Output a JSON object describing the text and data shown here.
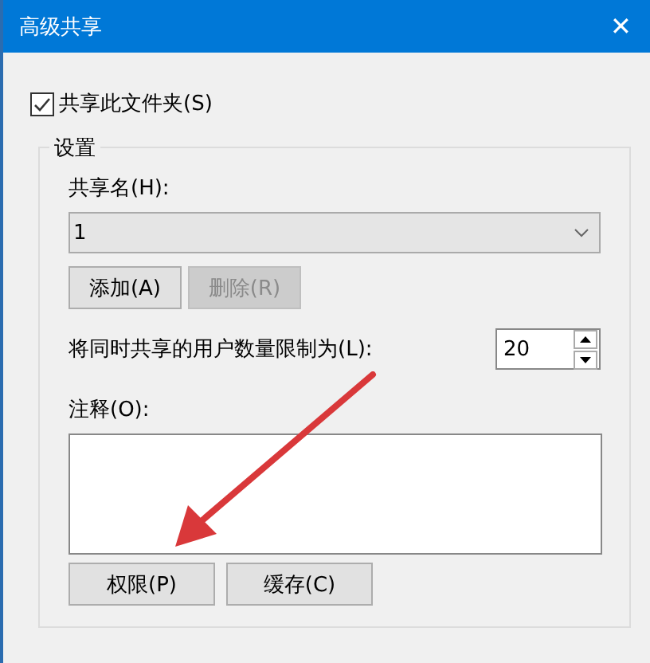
{
  "window": {
    "title": "高级共享",
    "close": "✕"
  },
  "share_checkbox": {
    "label": "共享此文件夹(S)",
    "checked": true
  },
  "settings": {
    "title": "设置",
    "share_name": {
      "label": "共享名(H):",
      "value": "1"
    },
    "buttons": [
      {
        "label": "添加(A)",
        "disabled": false
      },
      {
        "label": "删除(R)",
        "disabled": true
      }
    ],
    "user_limit": {
      "label": "将同时共享的用户数量限制为(L):",
      "value": "20"
    },
    "comment": {
      "label": "注释(O):"
    },
    "bottom_buttons": [
      {
        "label": "权限(P)",
        "disabled": false
      },
      {
        "label": "缓存(C)",
        "disabled": false
      }
    ]
  },
  "annotation": {
    "kind": "arrow"
  }
}
